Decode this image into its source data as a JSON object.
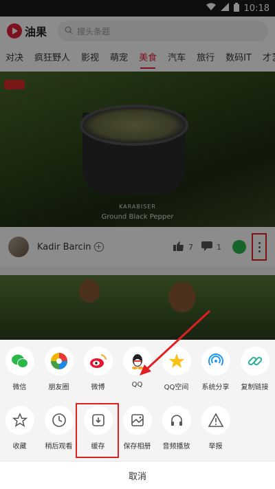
{
  "status_bar": {
    "time": "10:18"
  },
  "app": {
    "logo_text": "油果",
    "search_placeholder": "搜头条题"
  },
  "tabs": [
    "对决",
    "疯狂野人",
    "影视",
    "萌宠",
    "美食",
    "汽车",
    "旅行",
    "数码IT",
    "才艺"
  ],
  "active_tab_index": 4,
  "video": {
    "watermark_brand": "KARABISER",
    "watermark_caption": "Ground Black Pepper"
  },
  "author": {
    "name": "Kadir Barcin",
    "like_count": "7",
    "comment_count": "1"
  },
  "share_sheet": {
    "row1": [
      "微信",
      "朋友圈",
      "微博",
      "QQ",
      "QQ空间",
      "系统分享",
      "复制链接"
    ],
    "row2": [
      "收藏",
      "稍后观看",
      "缓存",
      "保存相册",
      "音频播放",
      "举报"
    ],
    "cancel_label": "取消"
  },
  "colors": {
    "brand_red": "#e2213b",
    "annotation_red": "#e02020"
  }
}
